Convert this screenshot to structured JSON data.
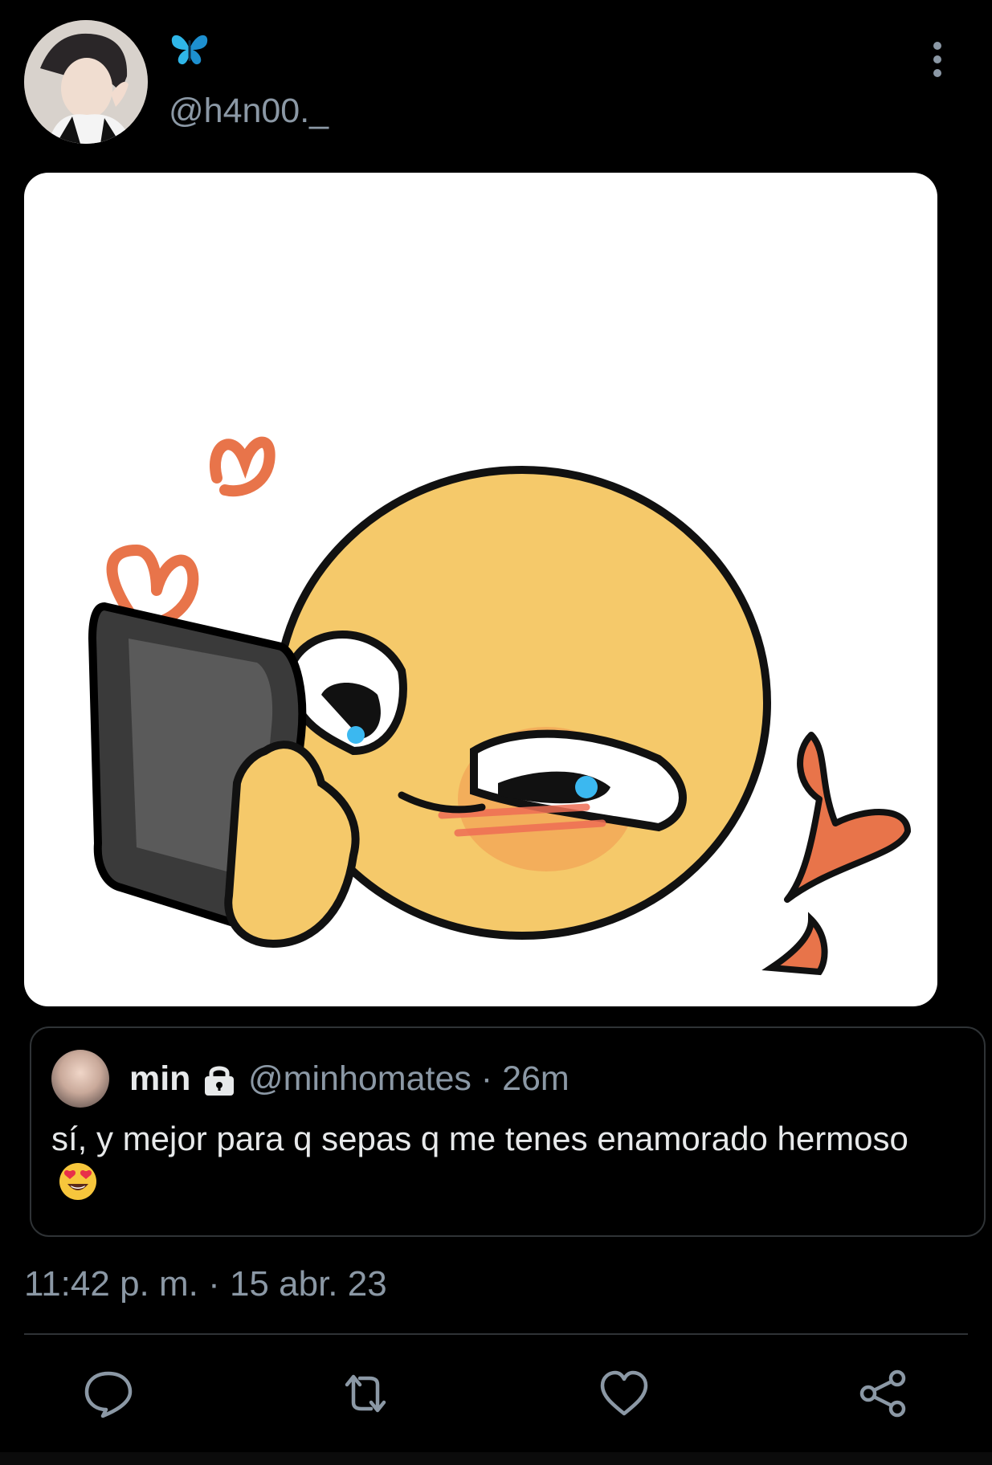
{
  "author": {
    "name_emoji": "🦋",
    "handle": "@h4n00._"
  },
  "quoted_tweet": {
    "name": "min",
    "handle_time": "@minhomates · 26m",
    "text": "sí, y mejor para q sepas q me tenes enamorado hermoso"
  },
  "timestamp": "11:42 p. m. · 15 abr. 23",
  "colors": {
    "background": "#000000",
    "text_primary": "#e7e9ea",
    "text_secondary": "#8b98a5",
    "border": "#2f3336",
    "butterfly": "#2fb6e8"
  },
  "icons": {
    "more": "more-vertical-icon",
    "reply": "reply-bubble-icon",
    "retweet": "retweet-icon",
    "like": "heart-icon",
    "share": "share-icon",
    "lock": "lock-icon",
    "emoji": "heart-eyes-emoji-icon"
  }
}
